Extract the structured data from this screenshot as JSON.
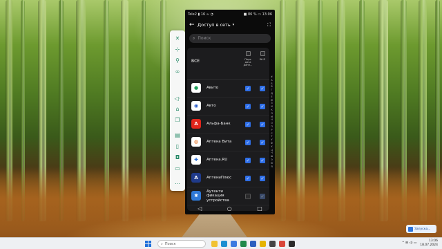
{
  "phone": {
    "status_left": "Tele2 ▮ 16 ≈ ◔",
    "status_right": "■ 86 % ▭ 13:06",
    "back_icon": "back-arrow-icon",
    "title": "Доступ в сеть",
    "title_arrow": "▾",
    "expand_icon": "⛶",
    "search_placeholder": "Поиск",
    "header": {
      "all_label": "ВСЕ",
      "col_mobile": "Пере\nдача\nданн...",
      "col_wifi": "Wi-Fi"
    },
    "apps": [
      {
        "name": "Авито",
        "icon": "avito-icon",
        "glyph": "●",
        "bg": "#ffffff",
        "fg": "#1f9e5a",
        "mobile": "on",
        "wifi": "on"
      },
      {
        "name": "Авто",
        "icon": "auto-icon",
        "glyph": "◉",
        "bg": "#ffffff",
        "fg": "#2458c9",
        "mobile": "on",
        "wifi": "on"
      },
      {
        "name": "Альфа-Банк",
        "icon": "alfa-bank-icon",
        "glyph": "А",
        "bg": "#e2261c",
        "fg": "#ffffff",
        "mobile": "on",
        "wifi": "on"
      },
      {
        "name": "Аптека Вита",
        "icon": "apteka-vita-icon",
        "glyph": "◍",
        "bg": "#ffffff",
        "fg": "#e56a1a",
        "mobile": "on",
        "wifi": "on"
      },
      {
        "name": "Аптека.RU",
        "icon": "apteka-ru-icon",
        "glyph": "✚",
        "bg": "#ffffff",
        "fg": "#2d6fd6",
        "mobile": "on",
        "wifi": "on"
      },
      {
        "name": "АптекиПлюс",
        "icon": "apteki-plus-icon",
        "glyph": "A",
        "bg": "#1f3a8a",
        "fg": "#ffffff",
        "mobile": "on",
        "wifi": "on"
      },
      {
        "name": "Аутенти\nфикация\nустройства",
        "icon": "authentication-icon",
        "glyph": "✱",
        "bg": "#2f78d6",
        "fg": "#ffffff",
        "mobile": "off",
        "wifi": "dim"
      }
    ],
    "alphabet": [
      "#",
      "А",
      "Б",
      "В",
      "Г",
      "Д",
      "Е",
      "Ж",
      "З",
      "И",
      "К",
      "Л",
      "М",
      "Н",
      "О",
      "П",
      "Р",
      "С",
      "Т",
      "У",
      "Ф",
      "Х",
      "Ц",
      "Ч",
      "Ш",
      "Э",
      "Ю",
      "Я"
    ],
    "nav": {
      "back": "◁",
      "home": "○",
      "recent": "□"
    }
  },
  "sidebar": {
    "buttons": [
      {
        "name": "close-icon",
        "glyph": "✕"
      },
      {
        "name": "pin-icon",
        "glyph": "⊹"
      },
      {
        "name": "link-icon",
        "glyph": "⚲"
      },
      {
        "name": "settings-icon",
        "glyph": "∞"
      },
      {
        "name": "volume-icon",
        "glyph": "◁·"
      },
      {
        "name": "home-icon",
        "glyph": "⌂"
      },
      {
        "name": "copy-icon",
        "glyph": "❐"
      },
      {
        "name": "screenshot-icon",
        "glyph": "▤"
      },
      {
        "name": "phone-icon",
        "glyph": "▯"
      },
      {
        "name": "camera-icon",
        "glyph": "◘"
      },
      {
        "name": "folder-icon",
        "glyph": "▭"
      },
      {
        "name": "more-icon",
        "glyph": "⋯"
      }
    ]
  },
  "notification": {
    "label": "Запуска..."
  },
  "taskbar": {
    "search_placeholder": "Поиск",
    "apps": [
      {
        "name": "file-explorer-icon",
        "color": "#f1c232"
      },
      {
        "name": "edge-icon",
        "color": "#1b8fd1"
      },
      {
        "name": "store-icon",
        "color": "#3b7be0"
      },
      {
        "name": "excel-icon",
        "color": "#1f8a4c"
      },
      {
        "name": "word-icon",
        "color": "#2b5fbf"
      },
      {
        "name": "yandex-icon",
        "color": "#e5b400"
      },
      {
        "name": "scrcpy-icon",
        "color": "#444444"
      },
      {
        "name": "chrome-icon",
        "color": "#d9473a"
      },
      {
        "name": "terminal-icon",
        "color": "#2b2b2b"
      }
    ],
    "tray_text": "^  ⊞  ◁)  ▭",
    "time": "13:06",
    "date": "18.07.2024"
  }
}
